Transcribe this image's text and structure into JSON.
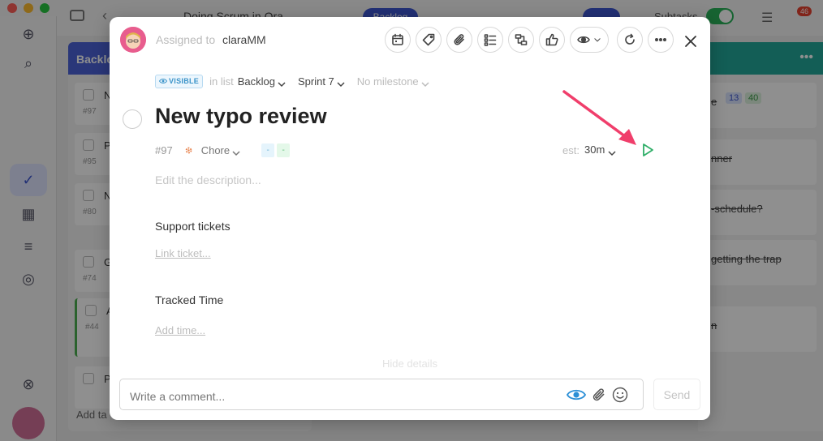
{
  "background": {
    "project_title": "Doing Scrum in Ora",
    "tab_backlog": "Backlog",
    "subtasks_label": "Subtasks",
    "notification_count": "46",
    "left_column": {
      "header": "Backlog",
      "cards": [
        {
          "label": "Ne",
          "num": "#97"
        },
        {
          "label": "Pr",
          "num": "#95"
        },
        {
          "label": "Ne",
          "num": "#80"
        },
        {
          "label": "Ga",
          "num": "#74"
        },
        {
          "label": "Al",
          "num": "#44"
        },
        {
          "label": "Pr",
          "num": ""
        }
      ],
      "add_label": "Add ta"
    },
    "right_column": {
      "cards": [
        {
          "label": "e"
        },
        {
          "label": "nner"
        },
        {
          "label": "-schedule?"
        },
        {
          "label": "getting the trap"
        },
        {
          "label": "n"
        }
      ],
      "badges": [
        "13",
        "40"
      ]
    }
  },
  "modal": {
    "assigned_prefix": "Assigned to",
    "assigned_user": "claraMM",
    "toolbar_icons": [
      "calendar-icon",
      "tag-icon",
      "paperclip-icon",
      "checklist-icon",
      "relations-icon",
      "thumbs-up-icon",
      "eye-icon",
      "repeat-icon",
      "more-icon"
    ],
    "visibility_badge": "VISIBLE",
    "in_list_label": "in list",
    "list_name": "Backlog",
    "sprint": "Sprint 7",
    "milestone": "No milestone",
    "title": "New typo review",
    "task_id": "#97",
    "task_type": "Chore",
    "tag_1": "-",
    "tag_2": "-",
    "estimate_label": "est:",
    "estimate_value": "30m",
    "description_placeholder": "Edit the description...",
    "support_title": "Support tickets",
    "support_link": "Link ticket...",
    "tracked_title": "Tracked Time",
    "tracked_link": "Add time...",
    "hide_details": "Hide details",
    "comment_placeholder": "Write a comment...",
    "send_label": "Send",
    "colors": {
      "play": "#2fae68",
      "visible_badge": "#3a93c9",
      "arrow": "#f03e6b"
    }
  }
}
